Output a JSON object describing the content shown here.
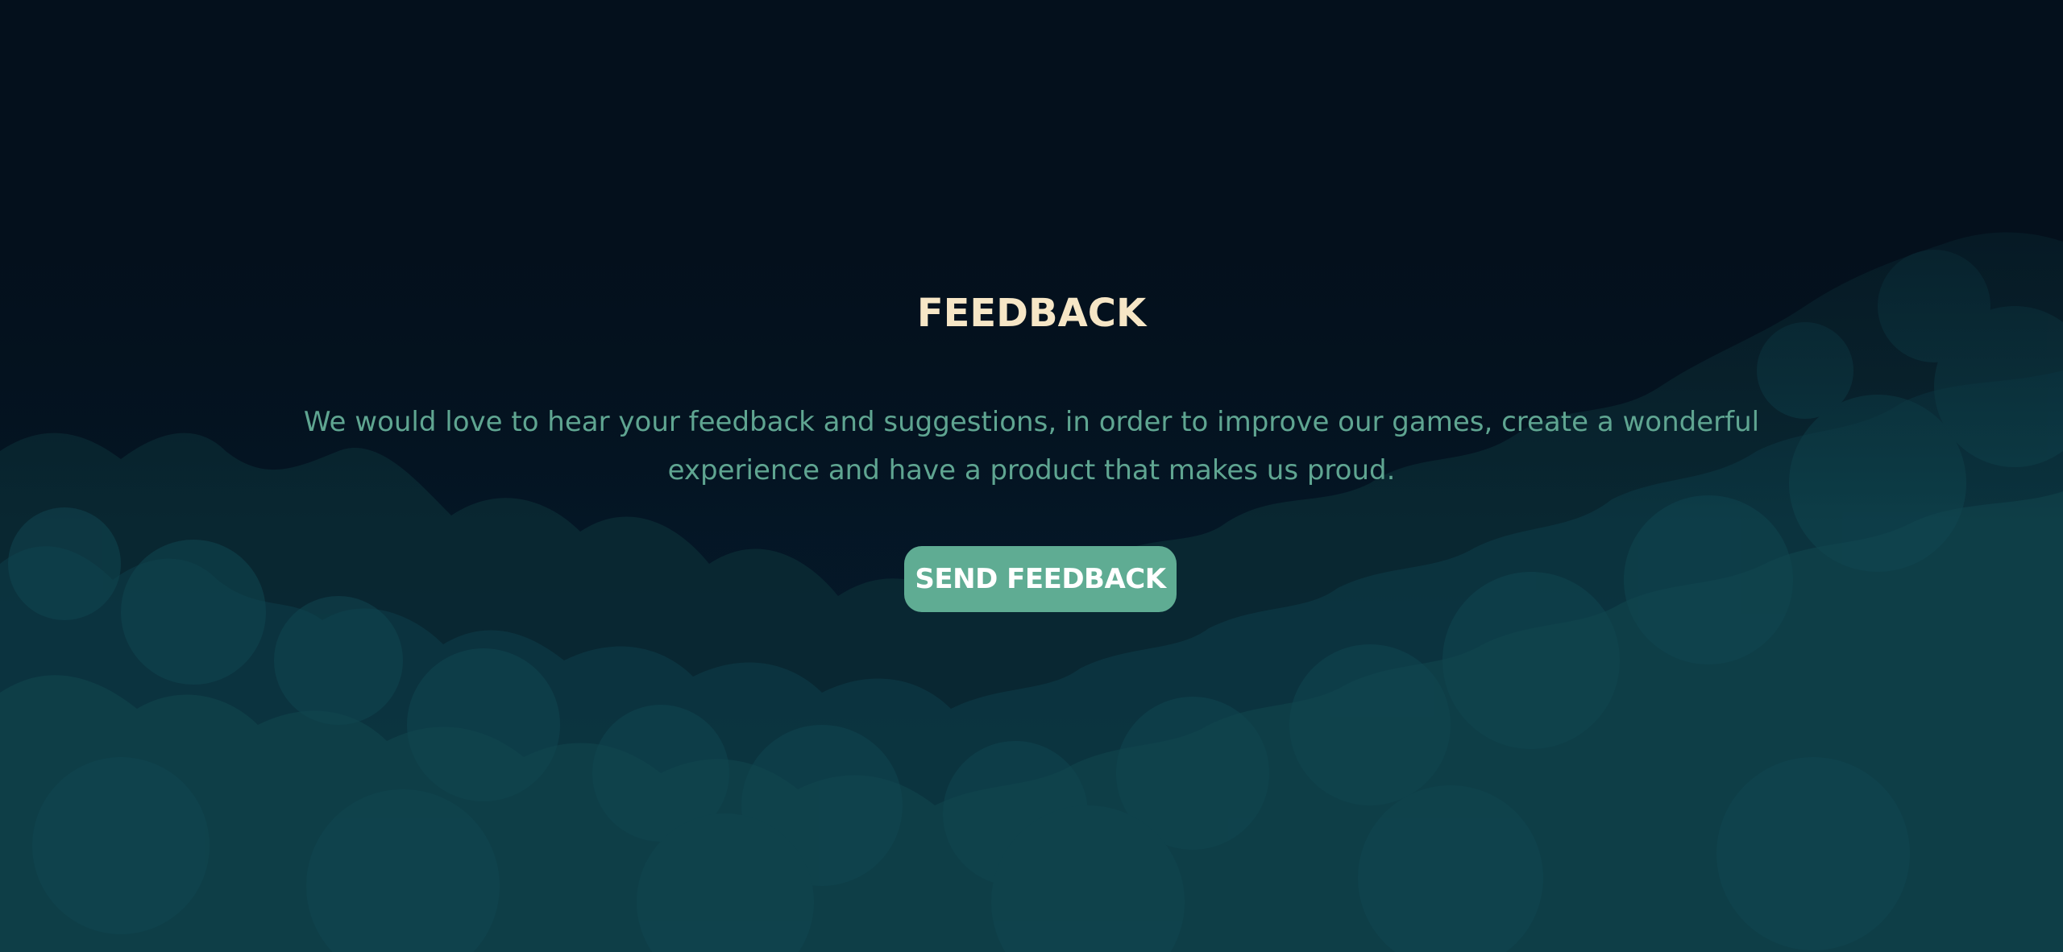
{
  "section": {
    "title": "FEEDBACK",
    "description": "We would love to hear your feedback and suggestions, in order to improve our games, create a wonderful experience and have a product that makes us proud.",
    "button_label": "SEND FEEDBACK"
  },
  "colors": {
    "background": "#04101c",
    "title": "#f6e6c6",
    "text": "#5fa591",
    "button": "#5fac93",
    "button_text": "#ffffff",
    "foliage": "#0d3b42"
  }
}
